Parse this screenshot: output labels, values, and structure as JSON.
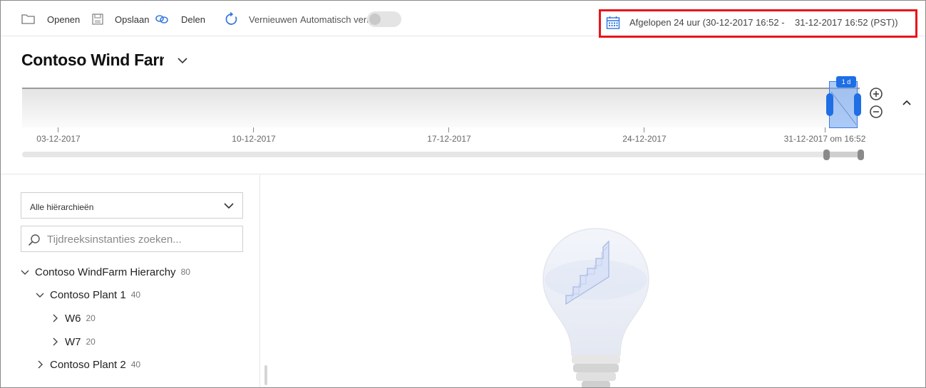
{
  "toolbar": {
    "open_label": "Openen",
    "save_label": "Opslaan",
    "share_label": "Delen",
    "refresh_label": "Vernieuwen",
    "auto_refresh_label": "Automatisch vernieuwen",
    "time_range": "Afgelopen 24 uur (30-12-2017 16:52 -    31-12-2017 16:52 (PST))"
  },
  "environment": {
    "title": "Contoso Wind Farm"
  },
  "timeline": {
    "brush_label": "1 d",
    "ticks": [
      "03-12-2017",
      "10-12-2017",
      "17-12-2017",
      "24-12-2017",
      "31-12-2017 om 16:52"
    ]
  },
  "hierarchy": {
    "selected": "Alle hiërarchieën",
    "search_placeholder": "Tijdreeksinstanties zoeken..."
  },
  "tree": [
    {
      "label": "Contoso WindFarm Hierarchy",
      "count": "80"
    },
    {
      "label": "Contoso Plant 1",
      "count": "40"
    },
    {
      "label": "W6",
      "count": "20"
    },
    {
      "label": "W7",
      "count": "20"
    },
    {
      "label": "Contoso Plant 2",
      "count": "40"
    }
  ],
  "colors": {
    "accent": "#1e6fe5",
    "highlight_border": "#e8141b"
  },
  "icons": {
    "open": "folder-icon",
    "save": "floppy-disk-icon",
    "share": "link-icon",
    "refresh": "refresh-icon",
    "calendar": "calendar-icon",
    "zoom_in": "zoom-in-icon",
    "zoom_out": "zoom-out-icon"
  }
}
